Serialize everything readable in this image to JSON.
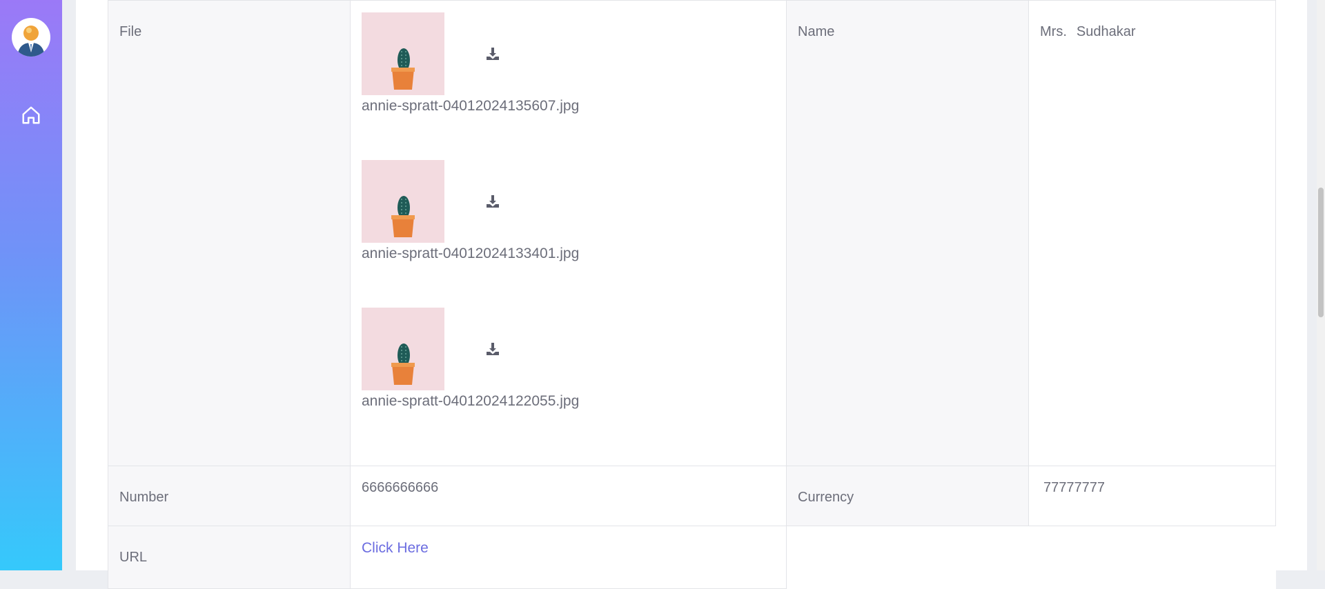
{
  "sidebar": {
    "avatar_icon": "user-avatar-icon",
    "home_icon": "home-icon"
  },
  "details": {
    "file_label": "File",
    "files": [
      {
        "filename": "annie-spratt-04012024135607.jpg",
        "thumbnail_icon": "cactus-image"
      },
      {
        "filename": "annie-spratt-04012024133401.jpg",
        "thumbnail_icon": "cactus-image"
      },
      {
        "filename": "annie-spratt-04012024122055.jpg",
        "thumbnail_icon": "cactus-image"
      }
    ],
    "download_icon": "download-icon",
    "name_label": "Name",
    "name_title": "Mrs.",
    "name_value": "Sudhakar",
    "number_label": "Number",
    "number_value": "6666666666",
    "currency_label": "Currency",
    "currency_value": "77777777",
    "url_label": "URL",
    "url_link_text": "Click Here"
  },
  "colors": {
    "sidebar_top": "#9b79f7",
    "sidebar_bottom": "#35c9fb",
    "link": "#6b6ce0",
    "label_bg": "#f7f7f9",
    "text": "#6c6e7a"
  }
}
